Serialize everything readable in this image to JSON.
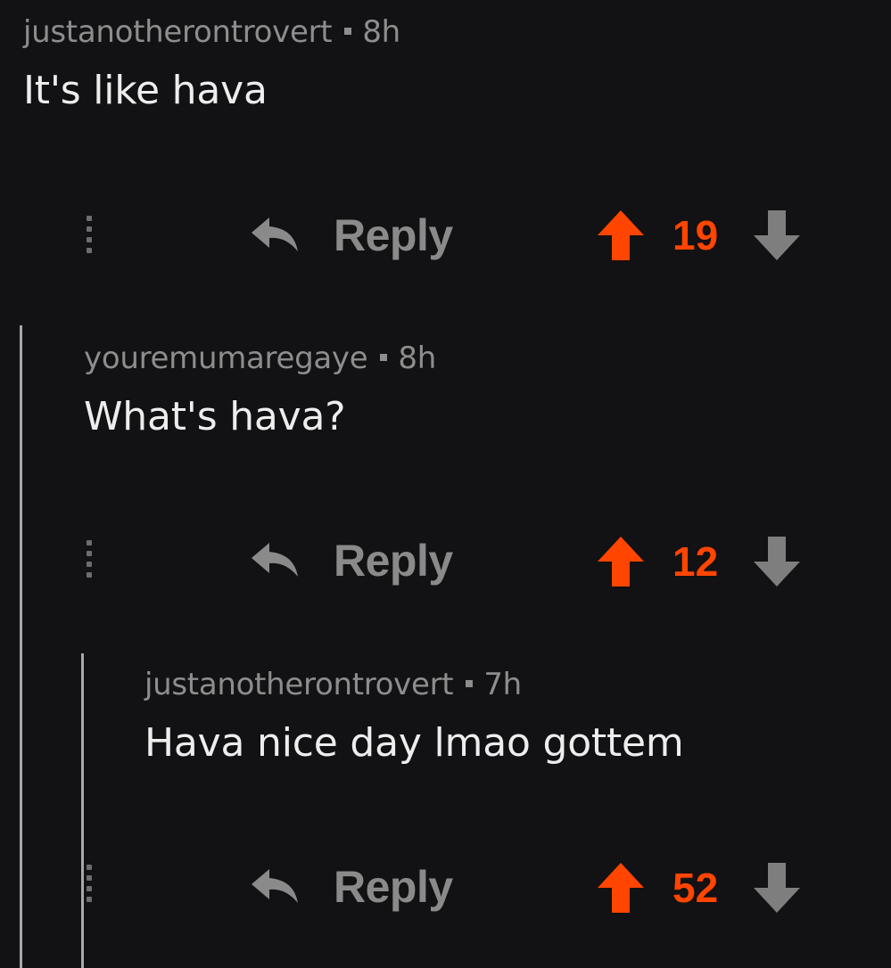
{
  "comments": [
    {
      "username": "justanotherontrovert",
      "age": "8h",
      "text": "It's like hava",
      "reply_label": "Reply",
      "score": "19"
    },
    {
      "username": "youremumaregaye",
      "age": "8h",
      "text": "What's hava?",
      "reply_label": "Reply",
      "score": "12"
    },
    {
      "username": "justanotherontrovert",
      "age": "7h",
      "text": "Hava nice day lmao gottem",
      "reply_label": "Reply",
      "score": "52"
    }
  ],
  "colors": {
    "background": "#121113",
    "upvote_active": "#ff4500",
    "muted": "#8a8a8a",
    "thread_line": "#a8a8a8"
  },
  "icons": {
    "more": "vertical-dots-icon",
    "reply": "reply-arrow-icon",
    "upvote": "upvote-arrow-icon",
    "downvote": "downvote-arrow-icon"
  }
}
